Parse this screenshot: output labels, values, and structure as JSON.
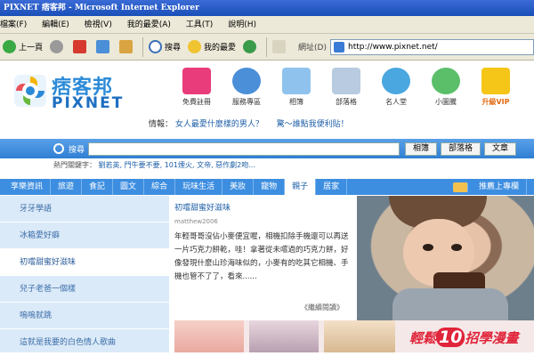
{
  "window": {
    "title": "PIXNET 痞客邦 - Microsoft Internet Explorer"
  },
  "menu": [
    "檔案(F)",
    "編輯(E)",
    "檢視(V)",
    "我的最愛(A)",
    "工具(T)",
    "說明(H)"
  ],
  "toolbar": {
    "back": "上一頁",
    "search": "搜尋",
    "favorites": "我的最愛",
    "address_label": "網址(D)",
    "address_value": "http://www.pixnet.net/"
  },
  "site": {
    "logo_cn": "痞客邦",
    "logo_en": "PIXNET",
    "icons": [
      "免費註冊",
      "服務專區",
      "相簿",
      "部落格",
      "名人堂",
      "小圖騰",
      "升級VIP"
    ],
    "news_prefix": "情報：",
    "news_1": "女人最愛什麼樣的男人？",
    "news_2": "驚～誰點我便利貼！",
    "search_label": "搜尋",
    "search_buttons": [
      "相簿",
      "部落格",
      "文章"
    ],
    "hot_label": "熱門關鍵字：",
    "hot_keywords": "劉若英, 門牛要不要, 101煙火, 文帝, 惡作劇2吻...",
    "nav": [
      "享樂資訊",
      "旅遊",
      "食記",
      "圖文",
      "綜合",
      "玩味生活",
      "美妝",
      "寵物",
      "親子",
      "居家"
    ],
    "nav_active": "親子",
    "recommend": "推薦上專欄",
    "sidebar": [
      "牙牙學語",
      "冰箱愛好癖",
      "初嚐甜蜜好滋味",
      "兒子老爸一個樣",
      "嗚嗚就跳",
      "這就是我要的白色情人歌曲"
    ],
    "article_title": "初嚐甜蜜好滋味",
    "article_author": "matthew2006",
    "article_body": "年輕哥哥沒佔小麥便宜喔，相機扣除手機還可以再送一片巧克力餅乾，哇！拿著從未嚐過的巧克力餅，好像發現什麼山珍海味似的，小麥有的吃其它相機、手機也管不了了，看來......",
    "article_more": "《繼續閱讀》",
    "promo_1": "輕鬆",
    "promo_2": "10",
    "promo_3": "招學漫畫"
  },
  "colors": {
    "accent": "#3d8ee0",
    "sidebar_bg": "#dbeaf8",
    "link": "#1e5fa8"
  }
}
